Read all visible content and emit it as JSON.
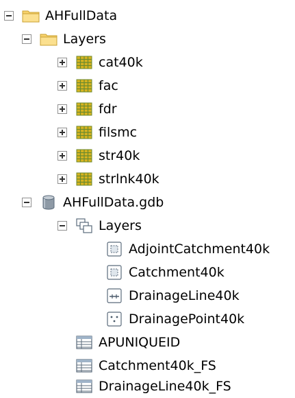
{
  "tree": {
    "folder": {
      "label": "AHFullData",
      "layers_folder": {
        "label": "Layers",
        "rasters": [
          {
            "label": "cat40k"
          },
          {
            "label": "fac"
          },
          {
            "label": "fdr"
          },
          {
            "label": "filsmc"
          },
          {
            "label": "str40k"
          },
          {
            "label": "strlnk40k"
          }
        ]
      },
      "gdb": {
        "label": "AHFullData.gdb",
        "dataset": {
          "label": "Layers",
          "feature_classes": [
            {
              "label": "AdjointCatchment40k",
              "icon": "polygon-feature-class-icon"
            },
            {
              "label": "Catchment40k",
              "icon": "polygon-feature-class-icon"
            },
            {
              "label": "DrainageLine40k",
              "icon": "line-feature-class-icon"
            },
            {
              "label": "DrainagePoint40k",
              "icon": "point-feature-class-icon"
            }
          ]
        },
        "tables": [
          {
            "label": "APUNIQUEID"
          },
          {
            "label": "Catchment40k_FS"
          },
          {
            "label": "DrainageLine40k_FS"
          }
        ]
      }
    }
  },
  "colors": {
    "folder_fill": "#f7d26c",
    "folder_border": "#c9a032",
    "raster_yellow": "#d8b420",
    "raster_green": "#6c8a2e",
    "gdb_body": "#8e9aa6",
    "icon_border": "#5b6b7b",
    "table_blue": "#9fb3c8"
  }
}
